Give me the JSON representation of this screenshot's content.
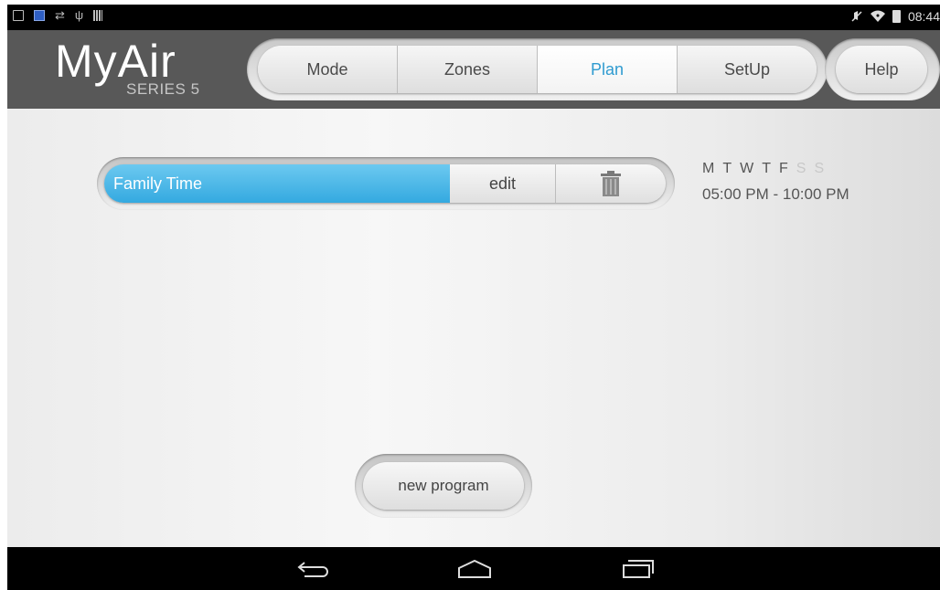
{
  "status_bar": {
    "time": "08:44",
    "left_icons": [
      "image-icon",
      "aa-icon",
      "sync-arrows-icon",
      "usb-icon",
      "barcode-icon"
    ],
    "right_icons": [
      "mute-icon",
      "wifi-icon",
      "battery-icon"
    ]
  },
  "header": {
    "logo": "MyAir",
    "logo_sub": "SERIES 5",
    "tabs": [
      {
        "label": "Mode",
        "active": false
      },
      {
        "label": "Zones",
        "active": false
      },
      {
        "label": "Plan",
        "active": true
      },
      {
        "label": "SetUp",
        "active": false
      }
    ],
    "help_label": "Help"
  },
  "program": {
    "name": "Family Time",
    "edit_label": "edit",
    "delete_icon": "trash-icon",
    "days": [
      {
        "label": "M",
        "enabled": true
      },
      {
        "label": "T",
        "enabled": true
      },
      {
        "label": "W",
        "enabled": true
      },
      {
        "label": "T",
        "enabled": true
      },
      {
        "label": "F",
        "enabled": true
      },
      {
        "label": "S",
        "enabled": false
      },
      {
        "label": "S",
        "enabled": false
      }
    ],
    "time_range": "05:00 PM - 10:00 PM"
  },
  "new_program_label": "new program",
  "nav": [
    "back-icon",
    "home-icon",
    "recent-apps-icon"
  ],
  "colors": {
    "accent": "#2f9bd0",
    "program_bar": "#34a9e0",
    "header_bg": "#585858"
  }
}
